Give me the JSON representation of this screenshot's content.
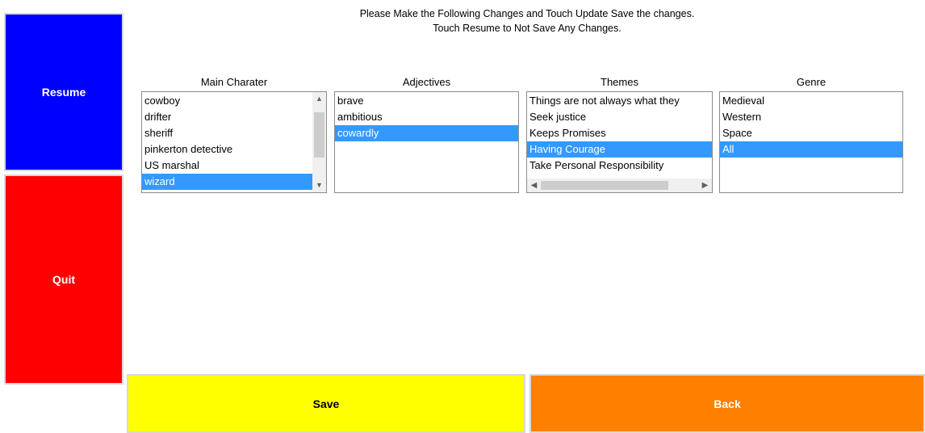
{
  "instructions": {
    "line1": "Please Make the Following Changes and Touch Update Save the changes.",
    "line2": "Touch Resume to Not Save Any Changes."
  },
  "buttons": {
    "resume": "Resume",
    "quit": "Quit",
    "save": "Save",
    "back": "Back"
  },
  "colors": {
    "resume": "#0000ff",
    "quit": "#ff0000",
    "save": "#ffff00",
    "back": "#ff7f00",
    "selection": "#3399ff"
  },
  "lists": {
    "main_character": {
      "label": "Main Charater",
      "items": [
        "cowboy",
        "drifter",
        "sheriff",
        "pinkerton detective",
        "US marshal",
        "wizard"
      ],
      "selected": [
        "wizard"
      ]
    },
    "adjectives": {
      "label": "Adjectives",
      "items": [
        "brave",
        "ambitious",
        "cowardly"
      ],
      "selected": [
        "cowardly"
      ]
    },
    "themes": {
      "label": "Themes",
      "items": [
        "Things are not always what they",
        "Seek justice",
        "Keeps Promises",
        "Having Courage",
        "Take Personal Responsibility"
      ],
      "selected": [
        "Having Courage"
      ]
    },
    "genre": {
      "label": "Genre",
      "items": [
        "Medieval",
        "Western",
        "Space",
        "All"
      ],
      "selected": [
        "All"
      ]
    }
  },
  "scrollbar_icons": {
    "up": "▲",
    "down": "▼",
    "left": "◀",
    "right": "▶"
  }
}
